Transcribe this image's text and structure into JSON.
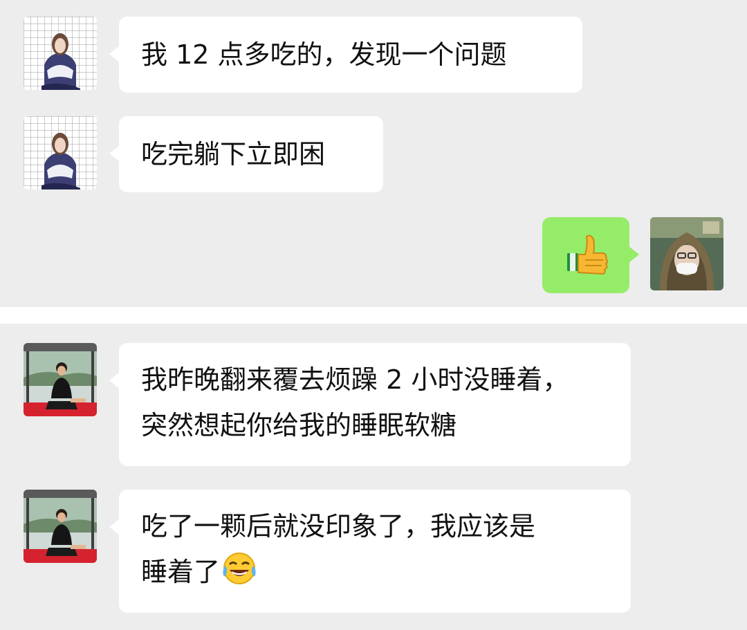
{
  "chat_top": {
    "messages": [
      {
        "side": "left",
        "sender": "contact-a",
        "text": "我 12 点多吃的，发现一个问题"
      },
      {
        "side": "left",
        "sender": "contact-a",
        "text": "吃完躺下立即困"
      },
      {
        "side": "right",
        "sender": "self",
        "sticker": "thumbs-up-emoji"
      }
    ]
  },
  "chat_bottom": {
    "messages": [
      {
        "side": "left",
        "sender": "contact-b",
        "lines": [
          "我昨晚翻来覆去烦躁 2 小时没睡着，",
          "突然想起你给我的睡眠软糖"
        ]
      },
      {
        "side": "left",
        "sender": "contact-b",
        "lines": [
          "吃了一颗后就没印象了，我应该是",
          "睡着了"
        ],
        "trailing_emoji": "tears-of-joy-emoji"
      }
    ]
  },
  "colors": {
    "chat_background": "#ededed",
    "incoming_bubble": "#ffffff",
    "outgoing_bubble": "#95ec69",
    "divider": "#ffffff",
    "text": "#111111"
  }
}
